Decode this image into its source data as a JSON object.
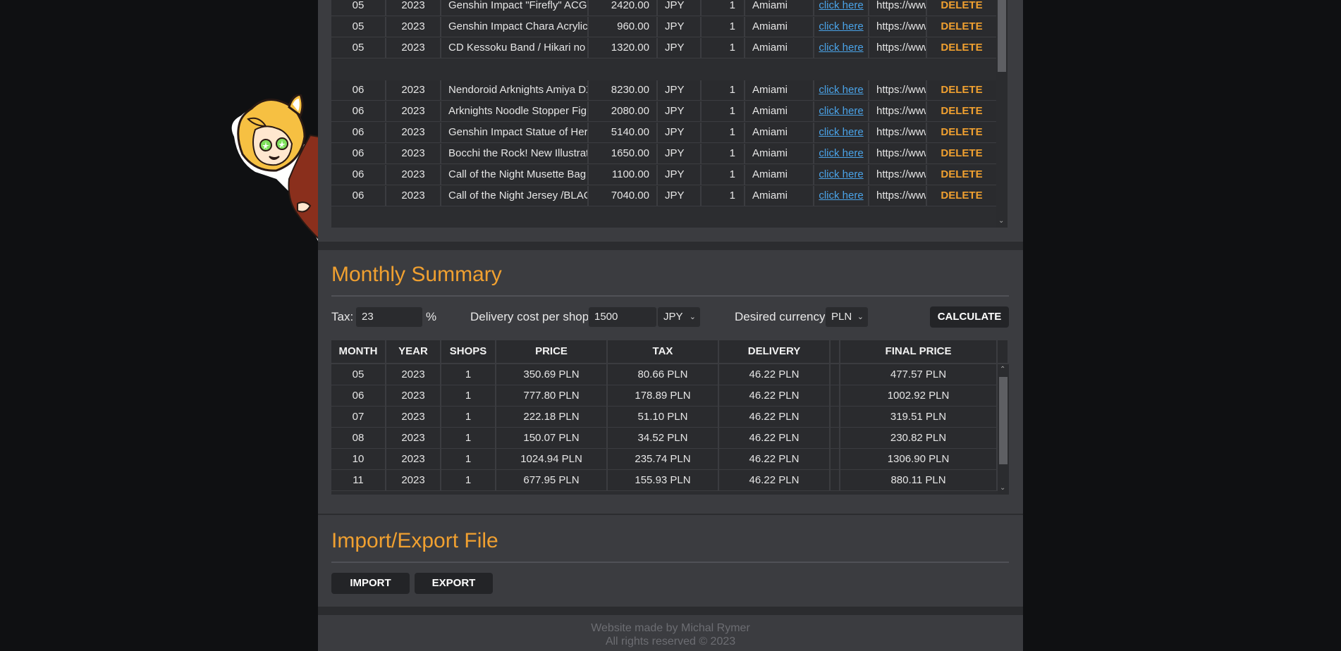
{
  "purchases": {
    "rows": [
      {
        "month": "05",
        "year": "2023",
        "name": "Genshin Impact \"Firefly\" ACG Card",
        "price": "2420.00",
        "currency": "JPY",
        "qty": "1",
        "shop": "Amiami",
        "link": "click here",
        "url": "https://www",
        "delete": "DELETE"
      },
      {
        "month": "05",
        "year": "2023",
        "name": "Genshin Impact Chara Acrylic",
        "price": "960.00",
        "currency": "JPY",
        "qty": "1",
        "shop": "Amiami",
        "link": "click here",
        "url": "https://www",
        "delete": "DELETE"
      },
      {
        "month": "05",
        "year": "2023",
        "name": "CD Kessoku Band / Hikari no Naka",
        "price": "1320.00",
        "currency": "JPY",
        "qty": "1",
        "shop": "Amiami",
        "link": "click here",
        "url": "https://www",
        "delete": "DELETE"
      },
      {
        "month": "06",
        "year": "2023",
        "name": "Nendoroid Arknights Amiya DX",
        "price": "8230.00",
        "currency": "JPY",
        "qty": "1",
        "shop": "Amiami",
        "link": "click here",
        "url": "https://www",
        "delete": "DELETE"
      },
      {
        "month": "06",
        "year": "2023",
        "name": "Arknights Noodle Stopper Figure",
        "price": "2080.00",
        "currency": "JPY",
        "qty": "1",
        "shop": "Amiami",
        "link": "click here",
        "url": "https://www",
        "delete": "DELETE"
      },
      {
        "month": "06",
        "year": "2023",
        "name": "Genshin Impact Statue of Her",
        "price": "5140.00",
        "currency": "JPY",
        "qty": "1",
        "shop": "Amiami",
        "link": "click here",
        "url": "https://www",
        "delete": "DELETE"
      },
      {
        "month": "06",
        "year": "2023",
        "name": "Bocchi the Rock! New Illustration",
        "price": "1650.00",
        "currency": "JPY",
        "qty": "1",
        "shop": "Amiami",
        "link": "click here",
        "url": "https://www",
        "delete": "DELETE"
      },
      {
        "month": "06",
        "year": "2023",
        "name": "Call of the Night Musette Bag",
        "price": "1100.00",
        "currency": "JPY",
        "qty": "1",
        "shop": "Amiami",
        "link": "click here",
        "url": "https://www",
        "delete": "DELETE"
      },
      {
        "month": "06",
        "year": "2023",
        "name": "Call of the Night Jersey /BLACK",
        "price": "7040.00",
        "currency": "JPY",
        "qty": "1",
        "shop": "Amiami",
        "link": "click here",
        "url": "https://www",
        "delete": "DELETE"
      }
    ]
  },
  "summary": {
    "title": "Monthly Summary",
    "tax_label": "Tax:",
    "tax_value": "23",
    "percent": "%",
    "delivery_label": "Delivery cost per shop:",
    "delivery_value": "1500",
    "delivery_currency": "JPY",
    "desired_label": "Desired currency:",
    "desired_currency": "PLN",
    "calculate": "CALCULATE",
    "headers": [
      "MONTH",
      "YEAR",
      "SHOPS",
      "PRICE",
      "TAX",
      "DELIVERY",
      "FINAL PRICE"
    ],
    "rows": [
      {
        "month": "05",
        "year": "2023",
        "shops": "1",
        "price": "350.69 PLN",
        "tax": "80.66 PLN",
        "delivery": "46.22 PLN",
        "final": "477.57 PLN"
      },
      {
        "month": "06",
        "year": "2023",
        "shops": "1",
        "price": "777.80 PLN",
        "tax": "178.89 PLN",
        "delivery": "46.22 PLN",
        "final": "1002.92 PLN"
      },
      {
        "month": "07",
        "year": "2023",
        "shops": "1",
        "price": "222.18 PLN",
        "tax": "51.10 PLN",
        "delivery": "46.22 PLN",
        "final": "319.51 PLN"
      },
      {
        "month": "08",
        "year": "2023",
        "shops": "1",
        "price": "150.07 PLN",
        "tax": "34.52 PLN",
        "delivery": "46.22 PLN",
        "final": "230.82 PLN"
      },
      {
        "month": "10",
        "year": "2023",
        "shops": "1",
        "price": "1024.94 PLN",
        "tax": "235.74 PLN",
        "delivery": "46.22 PLN",
        "final": "1306.90 PLN"
      },
      {
        "month": "11",
        "year": "2023",
        "shops": "1",
        "price": "677.95 PLN",
        "tax": "155.93 PLN",
        "delivery": "46.22 PLN",
        "final": "880.11 PLN"
      }
    ]
  },
  "io": {
    "title": "Import/Export File",
    "import": "IMPORT",
    "export": "EXPORT"
  },
  "footer": {
    "line1": "Website made by Michal Rymer",
    "line2": "All rights reserved © 2023"
  },
  "colors": {
    "accent": "#f0a030",
    "link": "#4aa3e8",
    "background": "#0f1012",
    "panel": "#3b3c40"
  }
}
